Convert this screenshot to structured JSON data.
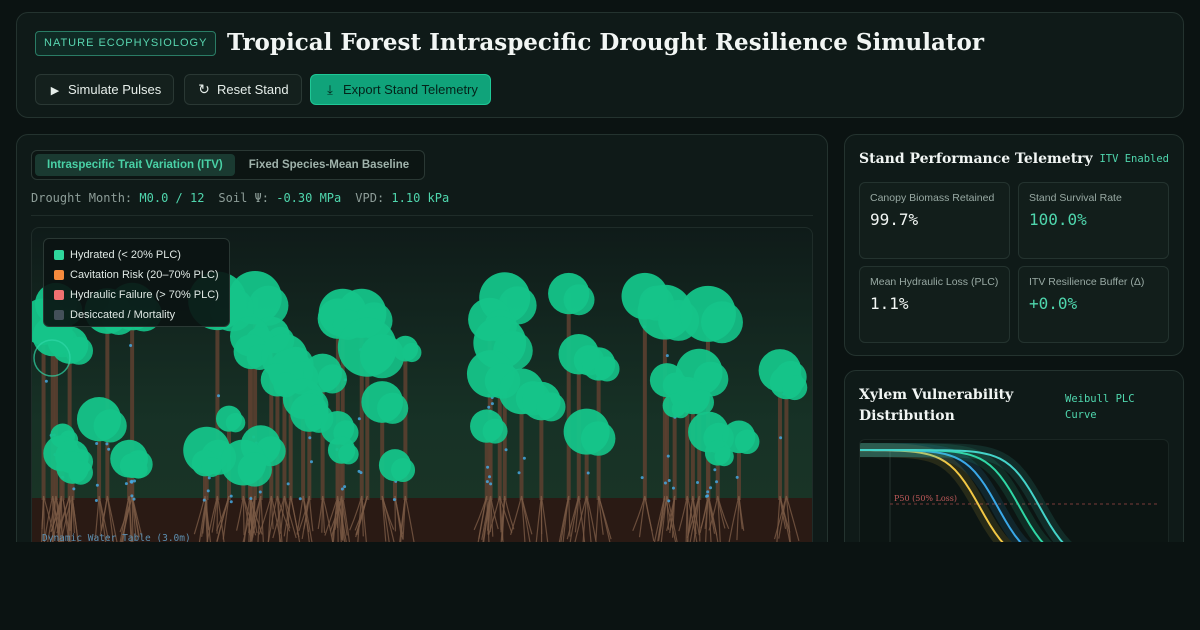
{
  "header": {
    "badge": "NATURE ECOPHYSIOLOGY",
    "title": "Tropical Forest Intraspecific Drought Resilience Simulator",
    "buttons": {
      "simulate": "Simulate Pulses",
      "reset": "Reset Stand",
      "export": "Export Stand Telemetry"
    }
  },
  "simulator": {
    "tabs": [
      "Intraspecific Trait Variation (ITV)",
      "Fixed Species-Mean Baseline"
    ],
    "active_tab": 0,
    "readout": {
      "month_label": "Drought Month:",
      "month_value": "M0.0 / 12",
      "soil_label": "Soil Ψ:",
      "soil_value": "-0.30 MPa",
      "vpd_label": "VPD:",
      "vpd_value": "1.10 kPa"
    },
    "legend": [
      {
        "label": "Hydrated (< 20% PLC)",
        "color": "#2fd79c"
      },
      {
        "label": "Cavitation Risk (20–70% PLC)",
        "color": "#f58a3d"
      },
      {
        "label": "Hydraulic Failure (> 70% PLC)",
        "color": "#f07070"
      },
      {
        "label": "Desiccated / Mortality",
        "color": "#44505a"
      }
    ],
    "water_table": "Dynamic Water Table (3.0m)",
    "colors": {
      "canopy": "#15c489",
      "trunk": "#5a3f30",
      "soil": "#2a1a14",
      "water": "#45a8e0"
    }
  },
  "telemetry": {
    "title": "Stand Performance Telemetry",
    "tag": "ITV Enabled",
    "cards": [
      {
        "label": "Canopy Biomass Retained",
        "value": "99.7%",
        "accent": false
      },
      {
        "label": "Stand Survival Rate",
        "value": "100.0%",
        "accent": true
      },
      {
        "label": "Mean Hydraulic Loss (PLC)",
        "value": "1.1%",
        "accent": false
      },
      {
        "label": "ITV Resilience Buffer (Δ)",
        "value": "+0.0%",
        "accent": true
      }
    ]
  },
  "xylem": {
    "title": "Xylem Vulnerability Distribution",
    "tag": "Weibull PLC Curve",
    "p50_label": "P50 (50% Loss)",
    "curve_colors": [
      "#f2c744",
      "#3aa8e8",
      "#2fd7a6",
      "#44d4c9"
    ]
  }
}
